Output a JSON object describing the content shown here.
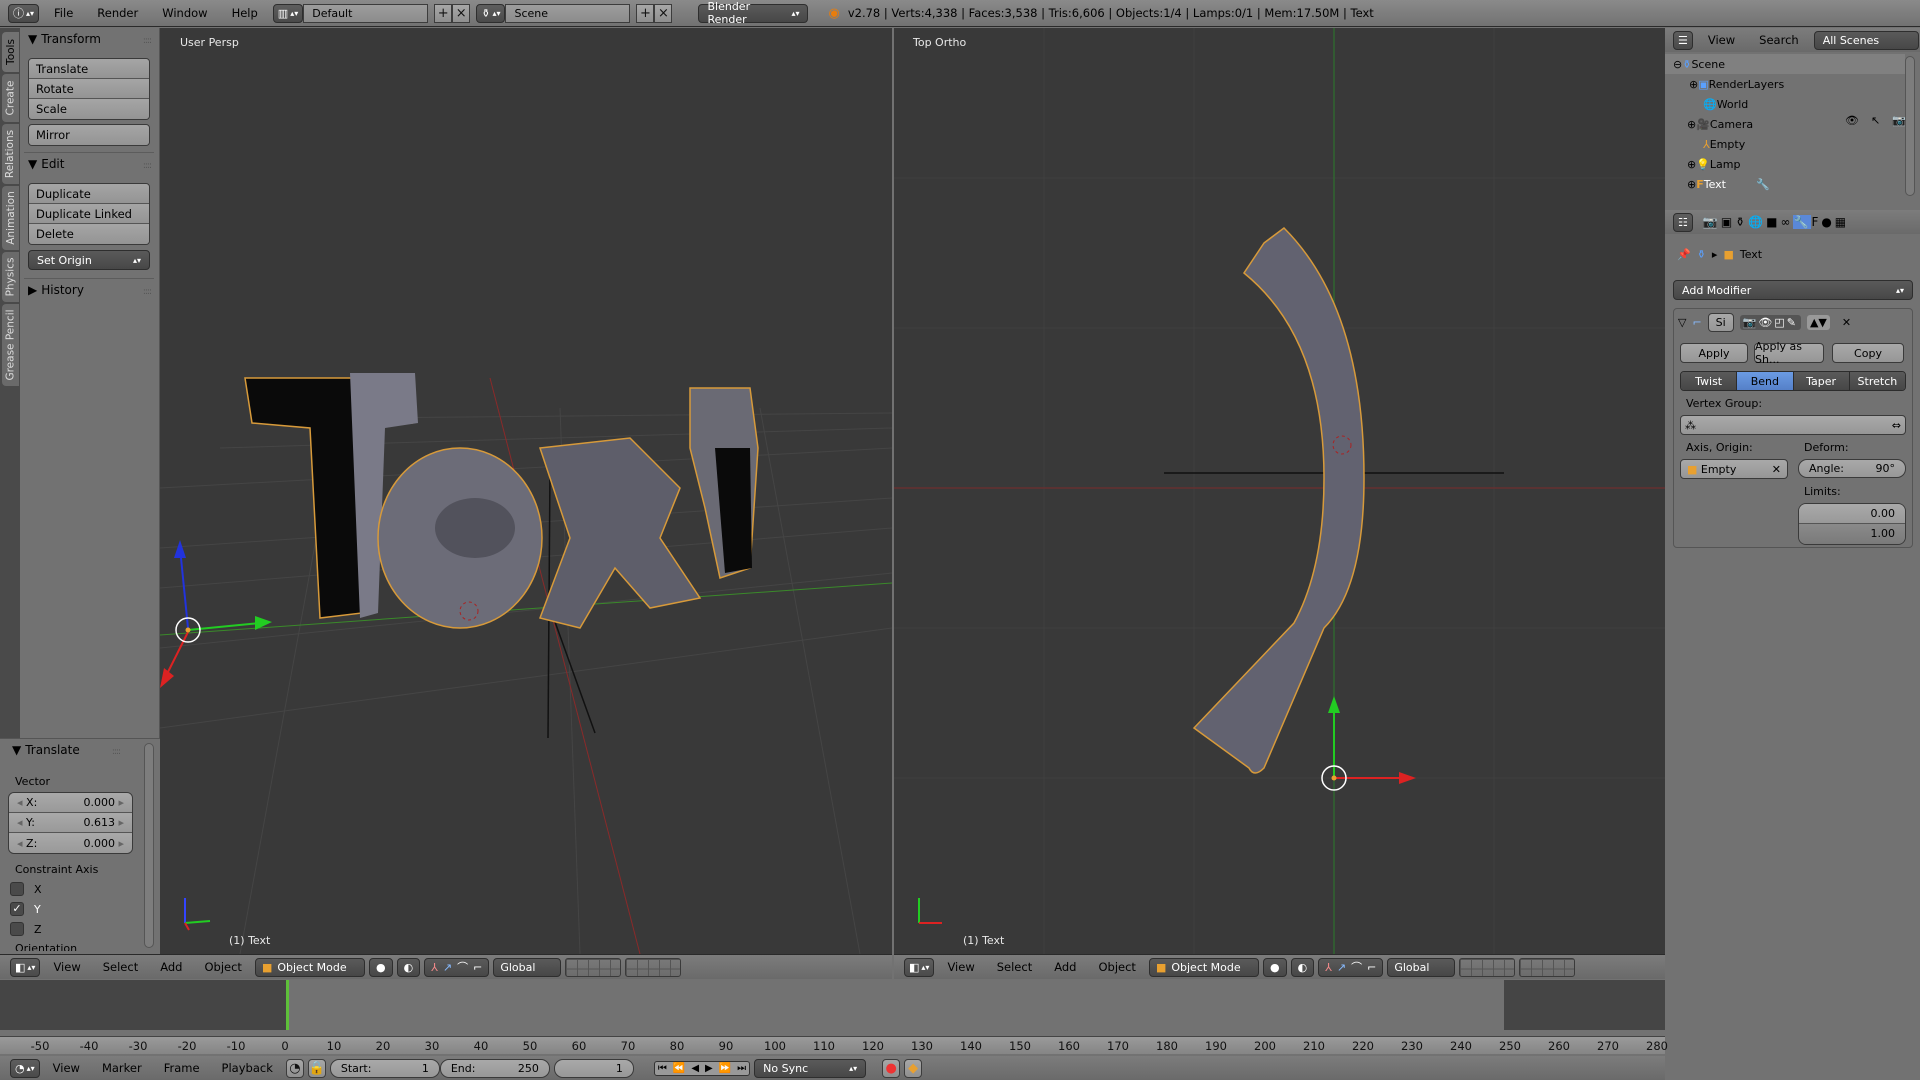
{
  "topbar": {
    "menus": [
      "File",
      "Render",
      "Window",
      "Help"
    ],
    "layout": "Default",
    "scene": "Scene",
    "engine": "Blender Render",
    "stats": "v2.78 | Verts:4,338 | Faces:3,538 | Tris:6,606 | Objects:1/4 | Lamps:0/1 | Mem:17.50M | Text"
  },
  "tool_tabs": [
    "Tools",
    "Create",
    "Relations",
    "Animation",
    "Physics",
    "Grease Pencil"
  ],
  "tool_shelf": {
    "transform": {
      "title": "Transform",
      "buttons": [
        "Translate",
        "Rotate",
        "Scale"
      ],
      "mirror": "Mirror"
    },
    "edit": {
      "title": "Edit",
      "buttons": [
        "Duplicate",
        "Duplicate Linked",
        "Delete"
      ],
      "set_origin": "Set Origin"
    },
    "history": {
      "title": "History"
    }
  },
  "redo_panel": {
    "title": "Translate",
    "vector_label": "Vector",
    "vector": [
      {
        "axis": "X:",
        "value": "0.000"
      },
      {
        "axis": "Y:",
        "value": "0.613"
      },
      {
        "axis": "Z:",
        "value": "0.000"
      }
    ],
    "constraint_label": "Constraint Axis",
    "constraints": [
      {
        "axis": "X",
        "checked": false
      },
      {
        "axis": "Y",
        "checked": true
      },
      {
        "axis": "Z",
        "checked": false
      }
    ],
    "orientation_label": "Orientation"
  },
  "viewport_left": {
    "label": "User Persp",
    "object": "(1) Text"
  },
  "viewport_right": {
    "label": "Top Ortho",
    "object": "(1) Text"
  },
  "viewport_header": {
    "menus": [
      "View",
      "Select",
      "Add",
      "Object"
    ],
    "mode": "Object Mode",
    "orientation": "Global"
  },
  "outliner": {
    "menus": [
      "View",
      "Search"
    ],
    "filter": "All Scenes",
    "items": [
      {
        "name": "Scene",
        "icon": "scene-icon",
        "level": 0
      },
      {
        "name": "RenderLayers",
        "icon": "renderlayers-icon",
        "level": 1
      },
      {
        "name": "World",
        "icon": "world-icon",
        "level": 1
      },
      {
        "name": "Camera",
        "icon": "camera-icon",
        "level": 1
      },
      {
        "name": "Empty",
        "icon": "empty-icon",
        "level": 1
      },
      {
        "name": "Lamp",
        "icon": "lamp-icon",
        "level": 1
      },
      {
        "name": "Text",
        "icon": "text-icon",
        "level": 1
      }
    ]
  },
  "properties": {
    "context": "Text",
    "add_modifier": "Add Modifier",
    "modifier_name": "Si",
    "apply": "Apply",
    "apply_shape": "Apply as Sh...",
    "copy": "Copy",
    "modes": [
      "Twist",
      "Bend",
      "Taper",
      "Stretch"
    ],
    "active_mode": "Bend",
    "vertex_group_label": "Vertex Group:",
    "axis_origin_label": "Axis, Origin:",
    "axis_origin_value": "Empty",
    "deform_label": "Deform:",
    "angle_label": "Angle:",
    "angle_value": "90°",
    "limits_label": "Limits:",
    "limit_min": "0.00",
    "limit_max": "1.00"
  },
  "timeline": {
    "ticks": [
      "-50",
      "-40",
      "-30",
      "-20",
      "-10",
      "0",
      "10",
      "20",
      "30",
      "40",
      "50",
      "60",
      "70",
      "80",
      "90",
      "100",
      "110",
      "120",
      "130",
      "140",
      "150",
      "160",
      "170",
      "180",
      "190",
      "200",
      "210",
      "220",
      "230",
      "240",
      "250",
      "260",
      "270",
      "280"
    ],
    "menus": [
      "View",
      "Marker",
      "Frame",
      "Playback"
    ],
    "start_label": "Start:",
    "start": "1",
    "end_label": "End:",
    "end": "250",
    "current": "1",
    "sync": "No Sync"
  }
}
